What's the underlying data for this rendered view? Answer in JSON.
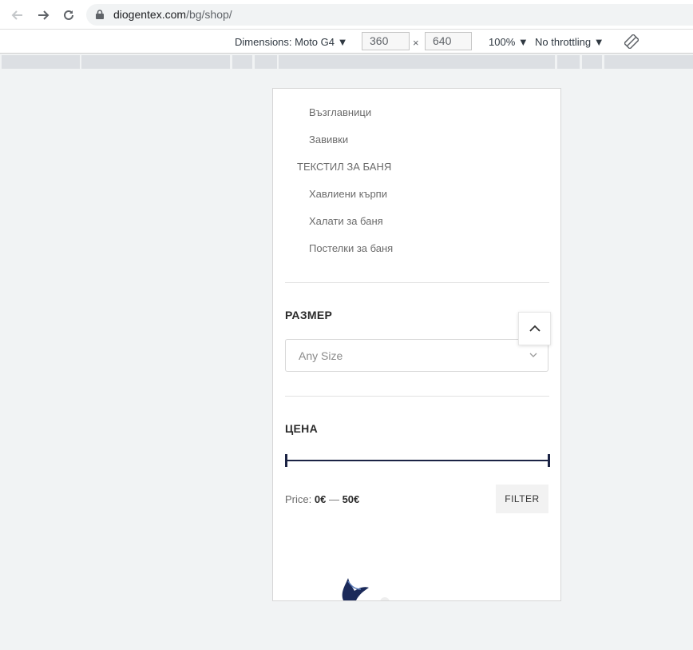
{
  "browser": {
    "url_host": "diogentex.com",
    "url_path": "/bg/shop/"
  },
  "device_toolbar": {
    "dimensions_label": "Dimensions: Moto G4",
    "width": "360",
    "times": "×",
    "height": "640",
    "zoom": "100%",
    "throttling": "No throttling"
  },
  "sidebar": {
    "categories": [
      {
        "label": "Възглавници"
      },
      {
        "label": "Завивки"
      },
      {
        "label": "ТЕКСТИЛ ЗА БАНЯ"
      },
      {
        "label": "Хавлиени кърпи"
      },
      {
        "label": "Халати за баня"
      },
      {
        "label": "Постелки за баня"
      }
    ]
  },
  "size_widget": {
    "title": "РАЗМЕР",
    "selected": "Any Size"
  },
  "price_widget": {
    "title": "ЦЕНА",
    "prefix": "Price:",
    "min": "0€",
    "sep": "—",
    "max": "50€",
    "range_min_value": 0,
    "range_max_value": 50,
    "button": "FILTER"
  },
  "colors": {
    "accent": "#1b2344",
    "text_muted": "#6b6b6b",
    "title": "#2b2b2b"
  }
}
